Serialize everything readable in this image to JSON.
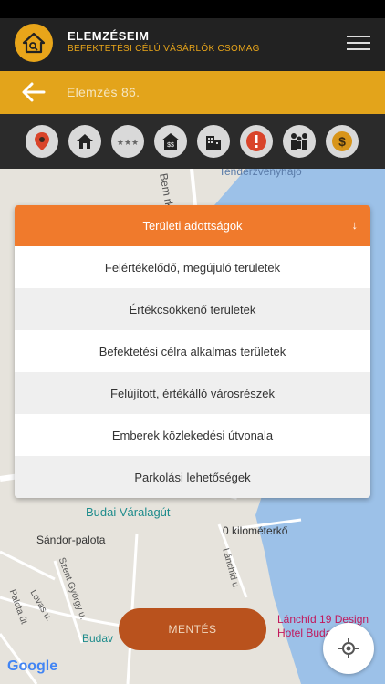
{
  "app": {
    "title": "ELEMZÉSEIM",
    "subtitle": "BEFEKTETÉSI CÉLÚ VÁSÁRLÓK CSOMAG"
  },
  "page": {
    "title": "Elemzés 86."
  },
  "colors": {
    "accent": "#e3a41b",
    "dropdown_header": "#f07a2c",
    "save_button": "#b9521d"
  },
  "categories": [
    {
      "icon": "map-pin-icon"
    },
    {
      "icon": "house-icon"
    },
    {
      "icon": "stars-icon"
    },
    {
      "icon": "price-house-icon"
    },
    {
      "icon": "buildings-icon"
    },
    {
      "icon": "alert-icon"
    },
    {
      "icon": "people-icon"
    },
    {
      "icon": "dollar-icon"
    }
  ],
  "dropdown": {
    "header": "Területi adottságok",
    "arrow": "↓",
    "items": [
      "Felértékelődő, megújuló területek",
      "Értékcsökkenő területek",
      "Befektetési célra alkalmas területek",
      "Felújított, értékálló városrészek",
      "Emberek közlekedési útvonala",
      "Parkolási lehetőségek"
    ]
  },
  "map": {
    "labels": {
      "street1": "Bem rkp.",
      "place1": "Tenderzvényhajó",
      "place2": "Budai Váralagút",
      "place3": "0 kilométerkő",
      "place4": "Sándor-palota",
      "street2": "Szent György u.",
      "street3": "Lánchíd u.",
      "street4": "Lovas u.",
      "street5": "Palota út",
      "place5": "Lánchíd 19 Design",
      "place6": "Hotel Buda",
      "place7": "Budav"
    },
    "attribution": "Google"
  },
  "save_label": "MENTÉS"
}
